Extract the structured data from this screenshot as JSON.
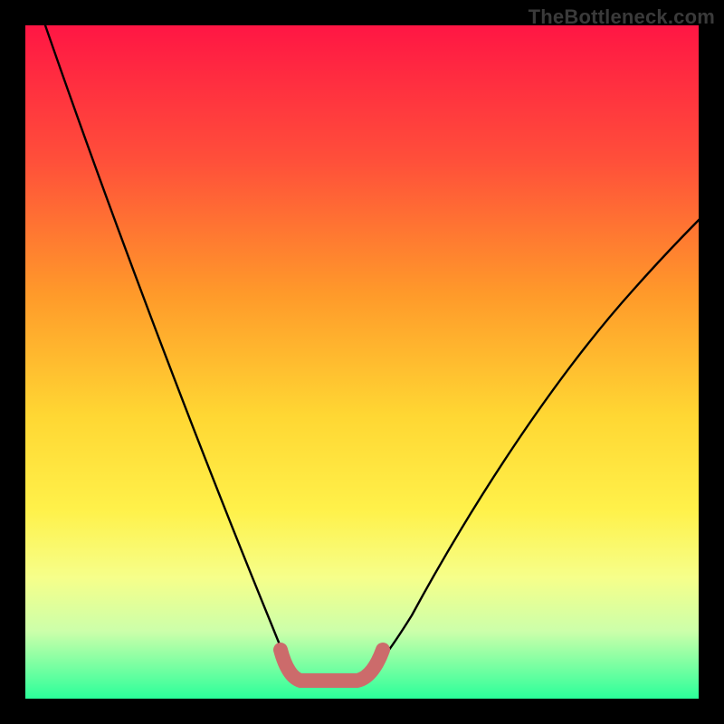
{
  "watermark": "TheBottleneck.com",
  "chart_data": {
    "type": "line",
    "title": "",
    "xlabel": "",
    "ylabel": "",
    "xlim": [
      0,
      100
    ],
    "ylim": [
      0,
      100
    ],
    "grid": false,
    "legend": false,
    "annotations": [],
    "series": [
      {
        "name": "bottleneck-curve",
        "x": [
          3,
          10,
          18,
          25,
          30,
          35,
          38,
          40,
          42,
          45,
          48,
          50,
          55,
          60,
          65,
          70,
          75,
          80,
          85,
          90,
          95,
          100
        ],
        "y": [
          100,
          83,
          66,
          50,
          38,
          25,
          15,
          8,
          3,
          3,
          3,
          8,
          15,
          25,
          33,
          40,
          46,
          52,
          57,
          62,
          67,
          72
        ]
      },
      {
        "name": "optimal-band",
        "x": [
          38,
          40,
          42,
          45,
          48,
          50
        ],
        "y": [
          8,
          3,
          3,
          3,
          3,
          8
        ]
      }
    ],
    "background_gradient": {
      "top": "#ff1644",
      "upper_mid": "#ff7a2a",
      "mid": "#ffe733",
      "lower_mid": "#f6ff8a",
      "band": "#ccffaa",
      "bottom": "#2bff9a"
    },
    "highlight_color": "#cc6b6b"
  }
}
